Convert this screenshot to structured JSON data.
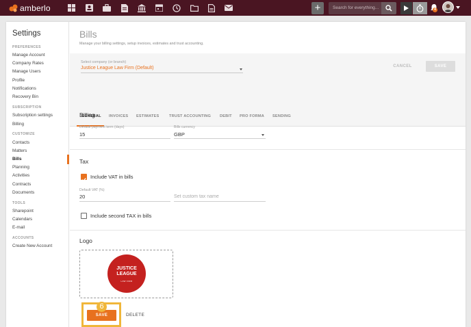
{
  "app": {
    "name": "amberlo"
  },
  "topbar": {
    "nav_icons": [
      "dashboard-icon",
      "contacts-icon",
      "matters-icon",
      "documents-icon",
      "bank-icon",
      "calendar-icon",
      "activities-icon",
      "folder-icon",
      "bills-icon",
      "mail-icon"
    ],
    "search_placeholder": "Search for everything...",
    "notification_count": "4",
    "colors": {
      "bar": "#4a1522",
      "accent": "#e8711e"
    }
  },
  "sidebar": {
    "title": "Settings",
    "sections": [
      {
        "label": "PREFERENCES",
        "items": [
          "Manage Account",
          "Company Rates",
          "Manage Users",
          "Profile",
          "Notifications",
          "Recovery Bin"
        ]
      },
      {
        "label": "SUBSCRIPTION",
        "items": [
          "Subscription settings",
          "Billing"
        ]
      },
      {
        "label": "CUSTOMIZE",
        "items": [
          "Contacts",
          "Matters",
          "Bills",
          "Planning",
          "Activities",
          "Contracts",
          "Documents"
        ]
      },
      {
        "label": "TOOLS",
        "items": [
          "Sharepoint",
          "Calendars",
          "E-mail"
        ]
      },
      {
        "label": "ACCOUNTS",
        "items": [
          "Create New Account"
        ]
      }
    ],
    "active_item": "Bills"
  },
  "page": {
    "title": "Bills",
    "subtitle": "Manage your billing settings, setup invoices, estimates and trust accounting."
  },
  "company": {
    "label": "Select company (or branch)",
    "value": "Justice League Law Firm (Default)"
  },
  "actions": {
    "cancel": "CANCEL",
    "save": "SAVE"
  },
  "tabs": [
    "GENERAL",
    "INVOICES",
    "ESTIMATES",
    "TRUST ACCOUNTING",
    "DEBIT",
    "PRO FORMA",
    "SENDING"
  ],
  "billing": {
    "title": "Billing",
    "payment_term_label": "Default payment term (days)",
    "payment_term_value": "15",
    "currency_label": "Bills currency",
    "currency_value": "GBP"
  },
  "tax": {
    "title": "Tax",
    "include_vat_label": "Include VAT in bills",
    "include_vat_checked": true,
    "default_vat_label": "Default VAT (%)",
    "default_vat_value": "20",
    "custom_tax_placeholder": "Set custom tax name",
    "second_tax_label": "Include second TAX in bills",
    "second_tax_checked": false
  },
  "logo": {
    "title": "Logo",
    "image_lines": [
      "JUSTICE",
      "LEAGUE",
      "LAW FIRM"
    ]
  },
  "logo_actions": {
    "save": "SAVE",
    "delete": "DELETE"
  },
  "step_badge": "6"
}
